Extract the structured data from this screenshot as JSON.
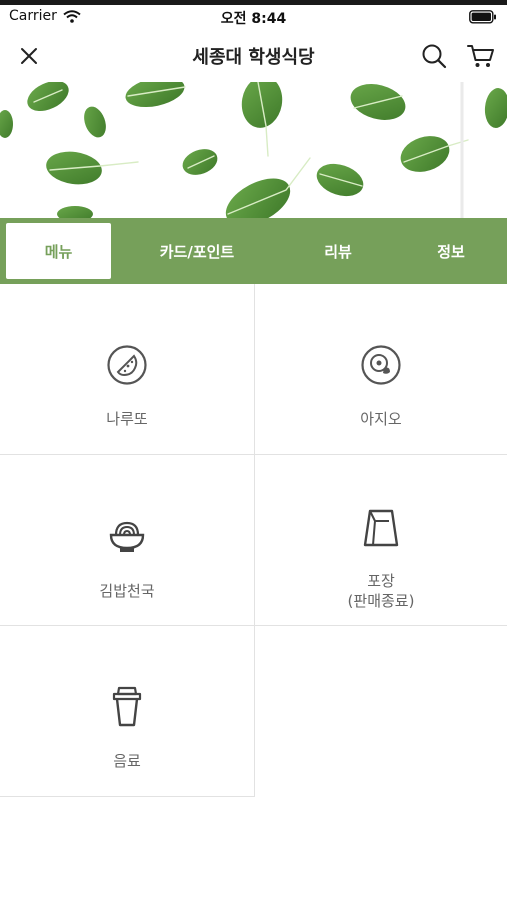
{
  "status_bar": {
    "carrier": "Carrier",
    "time": "오전 8:44"
  },
  "nav": {
    "title": "세종대 학생식당",
    "icons": [
      "close-icon",
      "search-icon",
      "cart-icon"
    ]
  },
  "tabs": [
    {
      "label": "메뉴",
      "active": true
    },
    {
      "label": "카드/포인트",
      "active": false
    },
    {
      "label": "리뷰",
      "active": false
    },
    {
      "label": "정보",
      "active": false
    }
  ],
  "categories": [
    {
      "label": "나루또",
      "icon": "pizza-plate-icon"
    },
    {
      "label": "아지오",
      "icon": "meal-plate-icon"
    },
    {
      "label": "김밥천국",
      "icon": "noodle-bowl-icon"
    },
    {
      "label": "포장",
      "sublabel": "(판매종료)",
      "icon": "takeout-bag-icon"
    },
    {
      "label": "음료",
      "icon": "drink-cup-icon"
    }
  ],
  "colors": {
    "accent": "#76a05a",
    "leaf": "#4f8a34",
    "divider": "#e2e2e2"
  }
}
